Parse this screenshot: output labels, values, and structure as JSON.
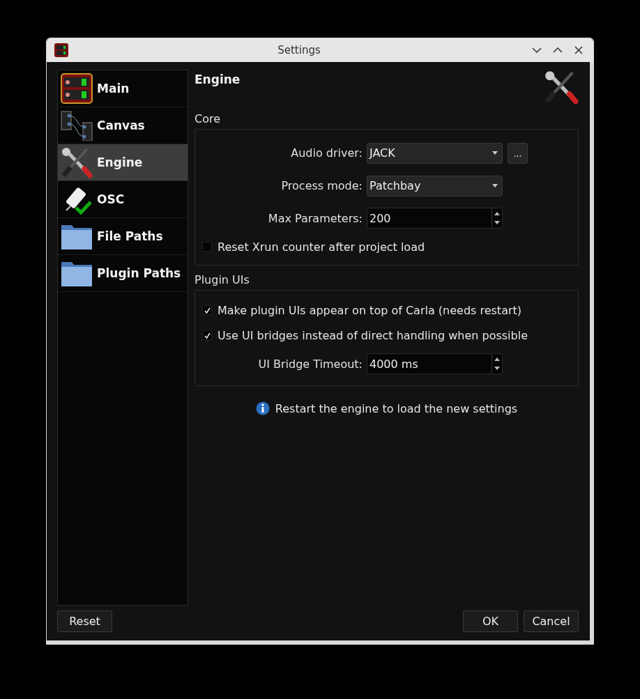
{
  "window": {
    "title": "Settings"
  },
  "sidebar": {
    "items": [
      {
        "label": "Main",
        "kind": "rack",
        "selected": false
      },
      {
        "label": "Canvas",
        "kind": "patch",
        "selected": false
      },
      {
        "label": "Engine",
        "kind": "tools",
        "selected": true
      },
      {
        "label": "OSC",
        "kind": "plug",
        "selected": false
      },
      {
        "label": "File Paths",
        "kind": "folder",
        "selected": false
      },
      {
        "label": "Plugin Paths",
        "kind": "folder",
        "selected": false
      }
    ]
  },
  "page": {
    "title": "Engine",
    "groups": [
      {
        "title": "Core",
        "rows": [
          {
            "kind": "combo",
            "label": "Audio driver:",
            "value": "JACK",
            "extra_button": "..."
          },
          {
            "kind": "combo",
            "label": "Process mode:",
            "value": "Patchbay"
          },
          {
            "kind": "spin",
            "label": "Max Parameters:",
            "value": "200"
          },
          {
            "kind": "check",
            "label": "Reset Xrun counter after project load",
            "checked": false
          }
        ]
      },
      {
        "title": "Plugin UIs",
        "rows": [
          {
            "kind": "check",
            "label": "Make plugin UIs appear on top of Carla (needs restart)",
            "checked": true
          },
          {
            "kind": "check",
            "label": "Use UI bridges instead of direct handling when possible",
            "checked": true
          },
          {
            "kind": "spin",
            "label": "UI Bridge Timeout:",
            "value": "4000 ms"
          }
        ]
      }
    ],
    "notice": "Restart the engine to load the new settings"
  },
  "buttons": {
    "left": [
      "Reset"
    ],
    "right": [
      "OK",
      "Cancel"
    ]
  }
}
